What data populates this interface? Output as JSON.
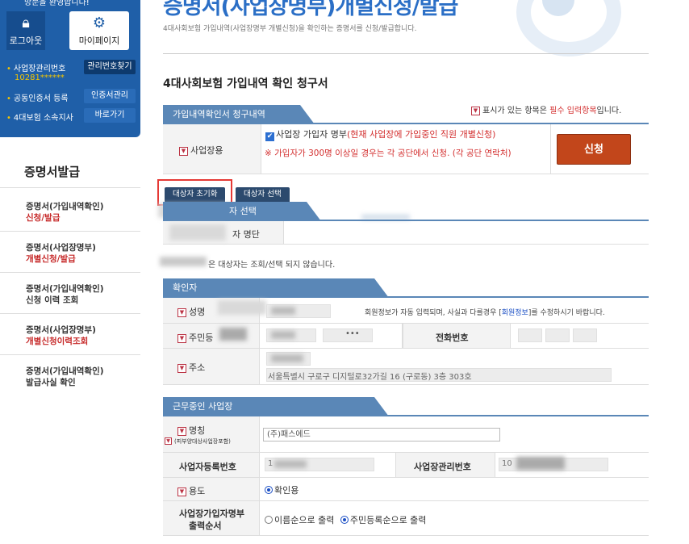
{
  "sidebar": {
    "welcome": "방문을 환영합니다!",
    "logout_label": "로그아웃",
    "mypage_label": "마이페이지",
    "workplace_no_label": "사업장관리번호",
    "workplace_no_value": "10281******",
    "find_no_label": "관리번호찾기",
    "cert_register_label": "공동인증서 등록",
    "cert_manage_label": "인증서관리",
    "branch_label": "4대보험 소속지사",
    "shortcut_label": "바로가기",
    "menu_title": "증명서발급",
    "menu": [
      {
        "line1": "증명서(가입내역확인)",
        "line2": "신청/발급"
      },
      {
        "line1": "증명서(사업장명부)",
        "line2": "개별신청/발급"
      },
      {
        "line1": "증명서(가입내역확인)",
        "line2": "신청 이력 조회"
      },
      {
        "line1": "증명서(사업장명부)",
        "line2": "개별신청이력조회"
      },
      {
        "line1": "증명서(가입내역확인)",
        "line2": "발급사실 확인"
      }
    ]
  },
  "header": {
    "title": "증명서(사업장명부)개별신청/발급",
    "subtitle": "4대사회보험 가입내역(사업장명부 개별신청)을 확인하는 증명서를 신청/발급합니다.",
    "form_title": "4대사회보험 가입내역 확인 청구서"
  },
  "request": {
    "section_label": "가입내역확인서 청구내역",
    "required_note_prefix": "표시가 있는 항목은 ",
    "required_note_red": "필수 입력항목",
    "required_note_suffix": "입니다.",
    "usage_label": "사업장용",
    "checkbox_text": "사업장 가입자 명부",
    "checkbox_note": "(현재 사업장에 가입중인 직원 개별신청)",
    "warning": "※ 가입자가 300명 이상일 경우는 각 공단에서 신청. (각 공단 연락처)",
    "apply_label": "신청"
  },
  "tabs": {
    "reset_label": "대상자 초기화",
    "select_label": "대상자 선택"
  },
  "target": {
    "section_label": "자 선택",
    "list_label": "자 명단",
    "note": "은 대상자는 조회/선택 되지 않습니다."
  },
  "confirmer": {
    "section_label": "확인자",
    "name_label": "성명",
    "name_note_prefix": "회원정보가 자동 입력되며, 사실과 다를경우 [",
    "name_note_link": "회원정보",
    "name_note_suffix": "]를 수정하시기 바랍니다.",
    "rrn_label": "주민등",
    "rrn_masked": "•••",
    "phone_label": "전화번호",
    "address_label": "주소",
    "address_value": "서울특별시 구로구 디지털로32가길 16 (구로동) 3층 303호"
  },
  "workplace": {
    "section_label": "근무중인 사업장",
    "name_label": "명칭",
    "name_sub_label": "(피부양대상사업장포함)",
    "name_value": "(주)패스에드",
    "reg_no_label": "사업자등록번호",
    "reg_no_value": "1",
    "mgmt_no_label": "사업장관리번호",
    "mgmt_no_value": "10",
    "purpose_label": "용도",
    "purpose_value": "확인용",
    "output_label_1": "사업장가입자명부",
    "output_label_2": "출력순서",
    "output_opt_name": "이름순으로 출력",
    "output_opt_rrn": "주민등록순으로 출력"
  },
  "colors": {
    "brand_blue": "#1f5fa8",
    "section_bar": "#5a87b7",
    "apply_button": "#c2461b",
    "highlight_box": "#e53935"
  }
}
